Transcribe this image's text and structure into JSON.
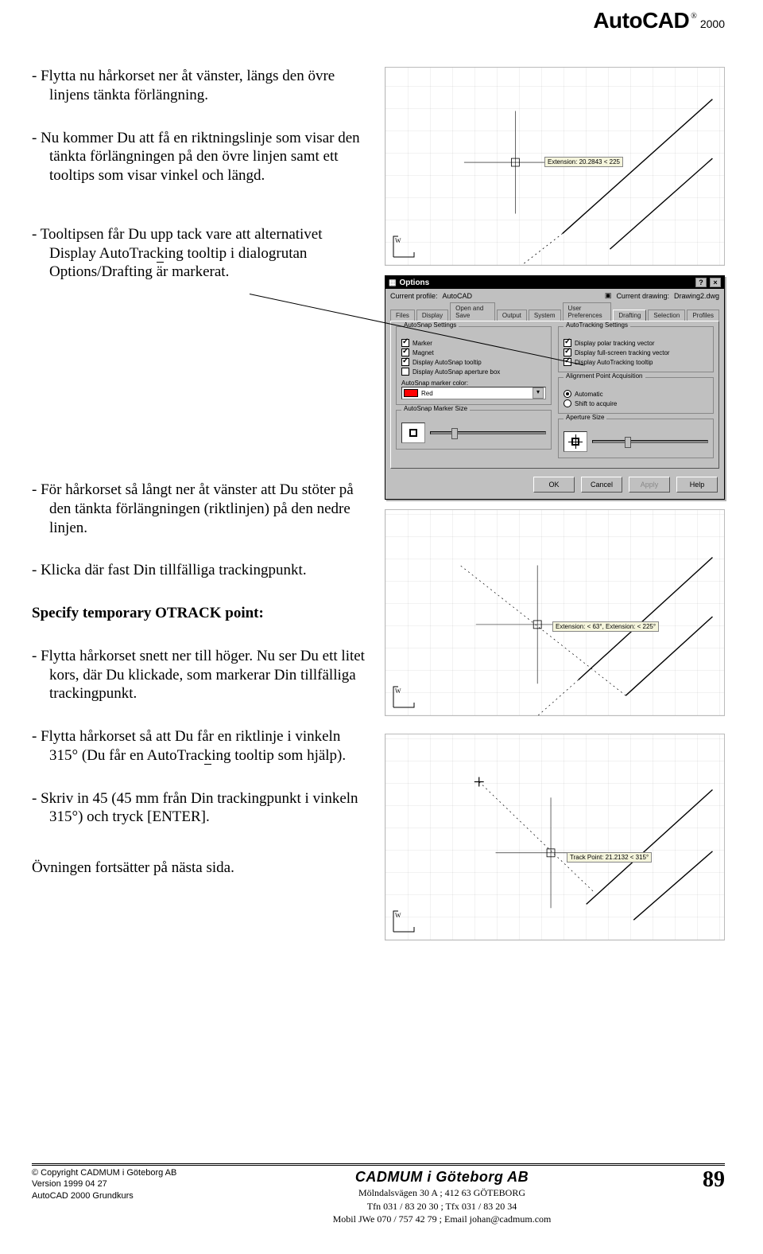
{
  "header": {
    "brand": "AutoCAD",
    "reg": "®",
    "year": "2000"
  },
  "body": {
    "p1": "- Flytta nu hårkorset ner åt vänster, längs den övre linjens tänkta förlängning.",
    "p2": "- Nu kommer Du att få en riktningslinje som visar den tänkta förlängningen på den övre linjen samt ett tooltips som visar vinkel och längd.",
    "p3a": "- Tooltipsen får Du upp tack vare att alternativet Display AutoTrac",
    "p3b": "k",
    "p3c": "ing tooltip i dialogrutan Options/Drafting är markerat.",
    "p4": "- För hårkorset så långt ner åt vänster att Du stöter på den tänkta förlängningen (rikt­linjen) på den nedre linjen.",
    "p5": "- Klicka där fast Din tillfälliga trackingpunkt.",
    "prompt": "Specify temporary OTRACK point:",
    "p6": "- Flytta hårkorset snett ner till höger. Nu ser Du ett litet kors, där Du klickade, som markerar Din tillfälliga trackingpunkt.",
    "p7a": "- Flytta hårkorset så att Du får en riktlinje i vinkeln 315° (Du får en AutoTrac",
    "p7b": "k",
    "p7c": "ing tooltip som hjälp).",
    "p8": "- Skriv in 45 (45 mm från Din trackingpunkt i vinkeln 315°) och tryck [ENTER].",
    "closing": "Övningen fortsätter på nästa sida."
  },
  "figures": {
    "fig1_tooltip": "Extension: 20.2843 < 225",
    "fig3_tooltip": "Extension: < 63°, Extension: < 225°",
    "fig4_tooltip": "Track Point: 21.2132 < 315°"
  },
  "dialog": {
    "title": "Options",
    "profile_label": "Current profile:",
    "profile_value": "AutoCAD",
    "drawing_label": "Current drawing:",
    "drawing_value": "Drawing2.dwg",
    "tabs": [
      "Files",
      "Display",
      "Open and Save",
      "Output",
      "System",
      "User Preferences",
      "Drafting",
      "Selection",
      "Profiles"
    ],
    "active_tab": "Drafting",
    "groups": {
      "autosnap": {
        "title": "AutoSnap Settings",
        "marker": "Marker",
        "magnet": "Magnet",
        "tooltip": "Display AutoSnap tooltip",
        "aperture": "Display AutoSnap aperture box",
        "color_label": "AutoSnap marker color:",
        "color_value": "Red"
      },
      "autotrack": {
        "title": "AutoTracking Settings",
        "polar": "Display polar tracking vector",
        "fullscreen": "Display full-screen tracking vector",
        "tooltip": "Display AutoTracking tooltip"
      },
      "alignment": {
        "title": "Alignment Point Acquisition",
        "auto": "Automatic",
        "shift": "Shift to acquire"
      },
      "markersize": {
        "title": "AutoSnap Marker Size"
      },
      "aperturesize": {
        "title": "Aperture Size"
      }
    },
    "buttons": {
      "ok": "OK",
      "cancel": "Cancel",
      "apply": "Apply",
      "help": "Help"
    }
  },
  "footer": {
    "copyright": "Copyright CADMUM i Göteborg AB",
    "version": "Version 1999 04 27",
    "course": "AutoCAD 2000 Grundkurs",
    "company": "CADMUM i Göteborg AB",
    "addr": "Mölndalsvägen 30 A ; 412 63 GÖTEBORG",
    "phone": "Tfn 031 / 83 20 30 ; Tfx 031 / 83 20 34",
    "mobile": "Mobil JWe 070 / 757 42 79 ; Email johan@cadmum.com",
    "page": "89"
  }
}
